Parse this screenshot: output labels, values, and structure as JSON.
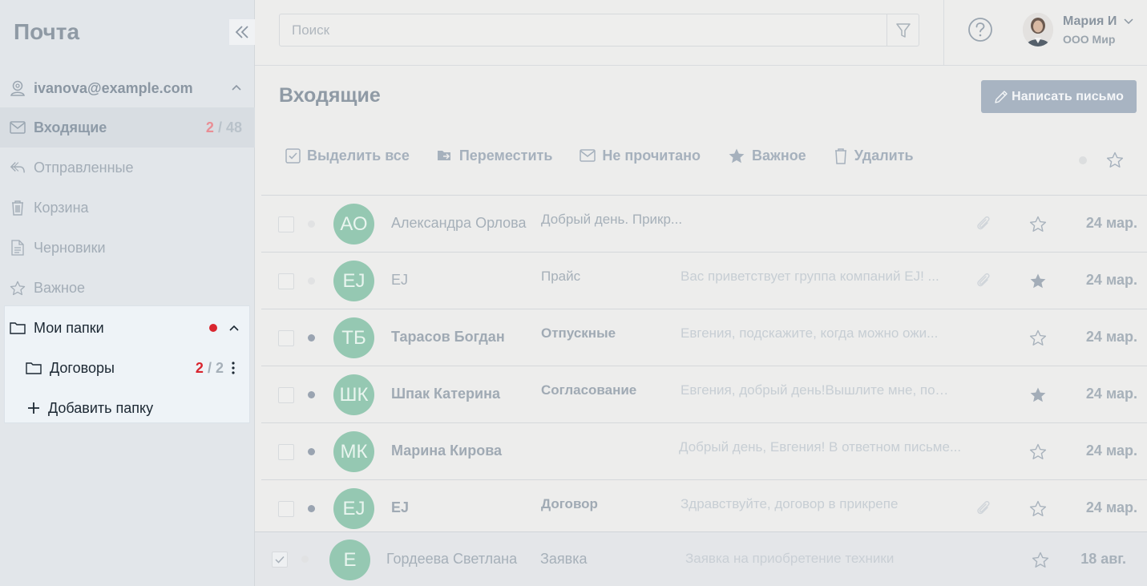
{
  "app": {
    "title": "Почта"
  },
  "sidebar": {
    "account": "ivanova@example.com",
    "items": [
      {
        "label": "Входящие",
        "icon": "mail-icon",
        "unread": "2",
        "separator": "/",
        "total": "48",
        "active": true
      },
      {
        "label": "Отправленные",
        "icon": "reply-icon"
      },
      {
        "label": "Корзина",
        "icon": "trash-icon"
      },
      {
        "label": "Черновики",
        "icon": "document-icon"
      },
      {
        "label": "Важное",
        "icon": "star-icon"
      }
    ],
    "my_folders": {
      "label": "Мои папки",
      "folders": [
        {
          "label": "Договоры",
          "unread": "2",
          "separator": "/",
          "total": "2"
        }
      ],
      "add_label": "Добавить папку"
    }
  },
  "search": {
    "placeholder": "Поиск",
    "value": ""
  },
  "user": {
    "name": "Мария И",
    "org": "ООО Мир"
  },
  "main": {
    "title": "Входящие",
    "compose_label": "Написать письмо",
    "toolbar": {
      "select_all": "Выделить все",
      "move": "Переместить",
      "unread": "Не прочитано",
      "important": "Важное",
      "delete": "Удалить"
    }
  },
  "emails": [
    {
      "initials": "АО",
      "sender": "Александра Орлова",
      "subject": "Добрый день. Прикр...",
      "preview": "",
      "attachment": true,
      "starred": false,
      "date": "24 мар.",
      "read": true
    },
    {
      "initials": "EJ",
      "sender": "EJ",
      "subject": "Прайс",
      "preview": "Вас приветствует группа компаний EJ! ...",
      "attachment": true,
      "starred": true,
      "date": "24 мар.",
      "read": true
    },
    {
      "initials": "ТБ",
      "sender": "Тарасов Богдан",
      "subject": "Отпускные",
      "preview": "Евгения, подскажите, когда можно ожи...",
      "attachment": false,
      "starred": false,
      "date": "24 мар.",
      "read": false
    },
    {
      "initials": "ШК",
      "sender": "Шпак Катерина",
      "subject": "Согласование",
      "preview": "Евгения, добрый день!Вышлите мне, пож...",
      "attachment": false,
      "starred": true,
      "date": "24 мар.",
      "read": false
    },
    {
      "initials": "МК",
      "sender": "Марина Кирова",
      "subject": "",
      "preview": "Добрый день, Евгения! В ответном письме...",
      "attachment": false,
      "starred": false,
      "date": "24 мар.",
      "read": false
    },
    {
      "initials": "EJ",
      "sender": "EJ",
      "subject": "Договор",
      "preview": "Здравствуйте, договор в прикрепе",
      "attachment": true,
      "starred": false,
      "date": "24 мар.",
      "read": false
    },
    {
      "initials": "Е",
      "sender": "Гордеева Светлана",
      "subject": "Заявка",
      "preview": "Заявка на приобретение техники",
      "attachment": false,
      "starred": false,
      "date": "18 авг.",
      "read": true,
      "selected": true
    }
  ],
  "colors": {
    "accent": "#a8b4c2",
    "avatar": "#95c8b2",
    "alert": "#d9252f"
  }
}
